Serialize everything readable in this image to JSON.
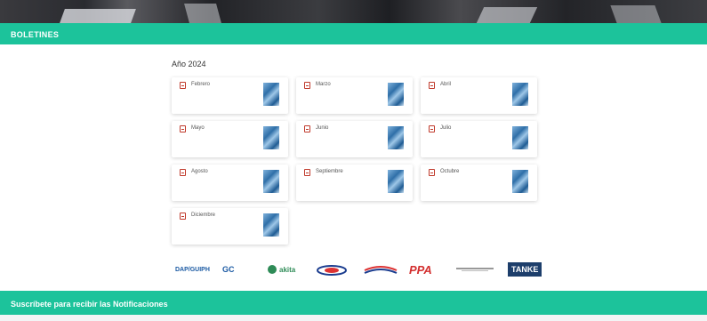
{
  "section_title": "BOLETINES",
  "year_title": "Año 2024",
  "months": [
    "Febrero",
    "Marzo",
    "Abril",
    "Mayo",
    "Junio",
    "Julio",
    "Agosto",
    "Septiembre",
    "Octubre",
    "Diciembre"
  ],
  "subscribe_bar": "Suscríbete para recibir las Notificaciones",
  "logos": [
    "DAP/GUIPH",
    "GC",
    "akita",
    "logo-4",
    "logo-5",
    "PPA",
    "logo-7",
    "TANKE"
  ],
  "colors": {
    "accent": "#1cc39b",
    "pdf_icon": "#c0392b"
  }
}
